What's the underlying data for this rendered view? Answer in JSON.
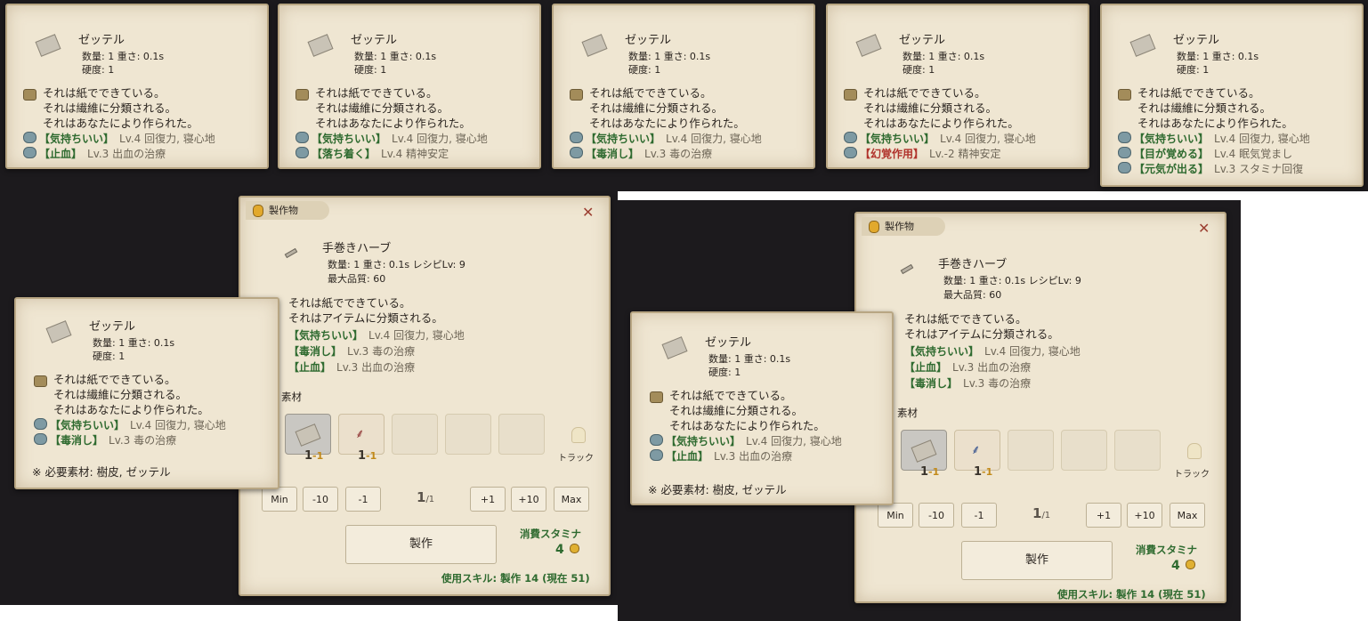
{
  "tooltips_top": [
    {
      "name": "ゼッテル",
      "meta_line1": "数量: 1  重さ: 0.1s",
      "meta_line2": "硬度: 1",
      "desc": [
        "それは紙でできている。",
        "それは繊維に分類される。",
        "それはあなたにより作られた。"
      ],
      "effects": [
        {
          "name": "【気持ちいい】",
          "detail": "Lv.4 回復力, 寝心地",
          "negative": false
        },
        {
          "name": "【止血】",
          "detail": "Lv.3 出血の治療",
          "negative": false
        }
      ]
    },
    {
      "name": "ゼッテル",
      "meta_line1": "数量: 1  重さ: 0.1s",
      "meta_line2": "硬度: 1",
      "desc": [
        "それは紙でできている。",
        "それは繊維に分類される。",
        "それはあなたにより作られた。"
      ],
      "effects": [
        {
          "name": "【気持ちいい】",
          "detail": "Lv.4 回復力, 寝心地",
          "negative": false
        },
        {
          "name": "【落ち着く】",
          "detail": "Lv.4 精神安定",
          "negative": false
        }
      ]
    },
    {
      "name": "ゼッテル",
      "meta_line1": "数量: 1  重さ: 0.1s",
      "meta_line2": "硬度: 1",
      "desc": [
        "それは紙でできている。",
        "それは繊維に分類される。",
        "それはあなたにより作られた。"
      ],
      "effects": [
        {
          "name": "【気持ちいい】",
          "detail": "Lv.4 回復力, 寝心地",
          "negative": false
        },
        {
          "name": "【毒消し】",
          "detail": "Lv.3 毒の治療",
          "negative": false
        }
      ]
    },
    {
      "name": "ゼッテル",
      "meta_line1": "数量: 1  重さ: 0.1s",
      "meta_line2": "硬度: 1",
      "desc": [
        "それは紙でできている。",
        "それは繊維に分類される。",
        "それはあなたにより作られた。"
      ],
      "effects": [
        {
          "name": "【気持ちいい】",
          "detail": "Lv.4 回復力, 寝心地",
          "negative": false
        },
        {
          "name": "【幻覚作用】",
          "detail": "Lv.-2 精神安定",
          "negative": true
        }
      ]
    },
    {
      "name": "ゼッテル",
      "meta_line1": "数量: 1  重さ: 0.1s",
      "meta_line2": "硬度: 1",
      "desc": [
        "それは紙でできている。",
        "それは繊維に分類される。",
        "それはあなたにより作られた。"
      ],
      "effects": [
        {
          "name": "【気持ちいい】",
          "detail": "Lv.4 回復力, 寝心地",
          "negative": false
        },
        {
          "name": "【目が覚める】",
          "detail": "Lv.4 眠気覚まし",
          "negative": false
        },
        {
          "name": "【元気が出る】",
          "detail": "Lv.3 スタミナ回復",
          "negative": false
        }
      ]
    }
  ],
  "craft_windows": [
    {
      "tab_label": "製作物",
      "product_name": "手巻きハーブ",
      "meta_line1": "数量: 1  重さ: 0.1s  レシピLv: 9",
      "meta_line2": "最大品質: 60",
      "desc": [
        "それは紙でできている。",
        "それはアイテムに分類される。"
      ],
      "effects": [
        {
          "name": "【気持ちいい】",
          "detail": "Lv.4 回復力, 寝心地"
        },
        {
          "name": "【毒消し】",
          "detail": "Lv.3 毒の治療"
        },
        {
          "name": "【止血】",
          "detail": "Lv.3 出血の治療"
        }
      ],
      "materials_label": "素材",
      "mat_qty": [
        "1",
        "1"
      ],
      "mat_neg": [
        "-1",
        "-1"
      ],
      "track_label": "トラック",
      "buttons": [
        "Min",
        "-10",
        "-1",
        "+1",
        "+10",
        "Max"
      ],
      "count_current": "1",
      "count_total": "/1",
      "craft_button": "製作",
      "stamina_label": "消費スタミナ",
      "stamina_value": "4",
      "skill_text": "使用スキル: 製作 14 (現在 51)",
      "tooltip": {
        "name": "ゼッテル",
        "meta_line1": "数量: 1  重さ: 0.1s",
        "meta_line2": "硬度: 1",
        "desc": [
          "それは紙でできている。",
          "それは繊維に分類される。",
          "それはあなたにより作られた。"
        ],
        "effects": [
          {
            "name": "【気持ちいい】",
            "detail": "Lv.4 回復力, 寝心地"
          },
          {
            "name": "【毒消し】",
            "detail": "Lv.3 毒の治療"
          }
        ],
        "note": "※ 必要素材: 樹皮, ゼッテル"
      }
    },
    {
      "tab_label": "製作物",
      "product_name": "手巻きハーブ",
      "meta_line1": "数量: 1  重さ: 0.1s  レシピLv: 9",
      "meta_line2": "最大品質: 60",
      "desc": [
        "それは紙でできている。",
        "それはアイテムに分類される。"
      ],
      "effects": [
        {
          "name": "【気持ちいい】",
          "detail": "Lv.4 回復力, 寝心地"
        },
        {
          "name": "【止血】",
          "detail": "Lv.3 出血の治療"
        },
        {
          "name": "【毒消し】",
          "detail": "Lv.3 毒の治療"
        }
      ],
      "materials_label": "素材",
      "mat_qty": [
        "1",
        "1"
      ],
      "mat_neg": [
        "-1",
        "-1"
      ],
      "track_label": "トラック",
      "buttons": [
        "Min",
        "-10",
        "-1",
        "+1",
        "+10",
        "Max"
      ],
      "count_current": "1",
      "count_total": "/1",
      "craft_button": "製作",
      "stamina_label": "消費スタミナ",
      "stamina_value": "4",
      "skill_text": "使用スキル: 製作 14 (現在 51)",
      "tooltip": {
        "name": "ゼッテル",
        "meta_line1": "数量: 1  重さ: 0.1s",
        "meta_line2": "硬度: 1",
        "desc": [
          "それは紙でできている。",
          "それは繊維に分類される。",
          "それはあなたにより作られた。"
        ],
        "effects": [
          {
            "name": "【気持ちいい】",
            "detail": "Lv.4 回復力, 寝心地"
          },
          {
            "name": "【止血】",
            "detail": "Lv.3 出血の治療"
          }
        ],
        "note": "※ 必要素材: 樹皮, ゼッテル"
      }
    }
  ]
}
